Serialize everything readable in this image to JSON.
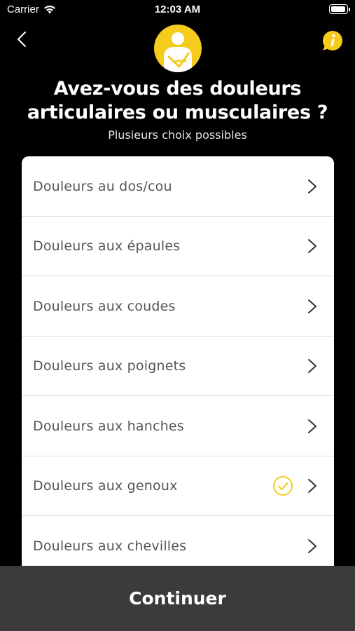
{
  "status_bar": {
    "carrier": "Carrier",
    "time": "12:03 AM",
    "icons": [
      "wifi-icon",
      "battery-icon"
    ]
  },
  "header": {
    "back_icon": "chevron-left-icon",
    "info_icon": "info-bubble-icon",
    "avatar_icon": "arm-sling-person-icon",
    "title": "Avez-vous des douleurs articulaires ou musculaires ?",
    "subtitle": "Plusieurs choix possibles"
  },
  "options": [
    {
      "label": "Douleurs au dos/cou",
      "selected": false
    },
    {
      "label": "Douleurs aux épaules",
      "selected": false
    },
    {
      "label": "Douleurs aux coudes",
      "selected": false
    },
    {
      "label": "Douleurs aux poignets",
      "selected": false
    },
    {
      "label": "Douleurs aux hanches",
      "selected": false
    },
    {
      "label": "Douleurs aux genoux",
      "selected": true
    },
    {
      "label": "Douleurs aux chevilles",
      "selected": false
    }
  ],
  "footer": {
    "continue_label": "Continuer"
  },
  "colors": {
    "accent": "#f5cb1c",
    "background": "#000000",
    "footer_bg": "#3b3b3b",
    "row_text": "#555555"
  }
}
